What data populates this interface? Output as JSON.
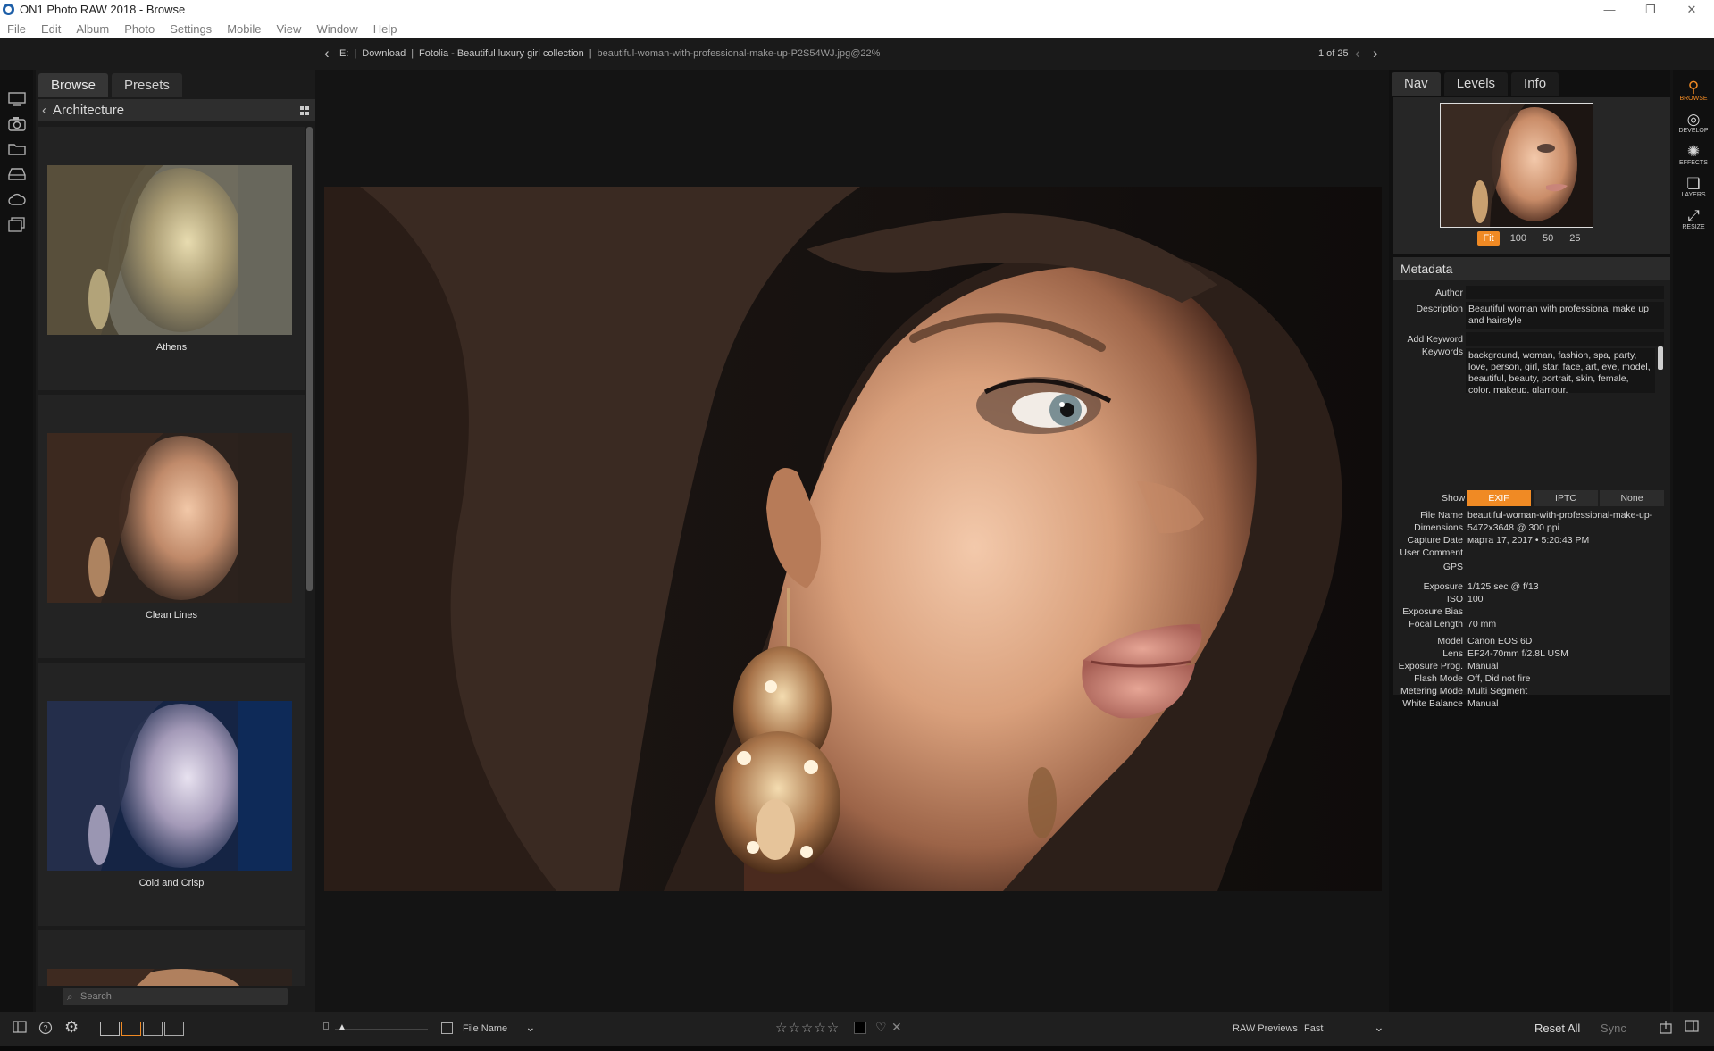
{
  "window": {
    "title": "ON1 Photo RAW 2018 - Browse",
    "controls": [
      "—",
      "❐",
      "✕"
    ]
  },
  "menu": [
    "File",
    "Edit",
    "Album",
    "Photo",
    "Settings",
    "Mobile",
    "View",
    "Window",
    "Help"
  ],
  "pathbar": {
    "drive": "E:",
    "folder1": "Download",
    "folder2": "Fotolia - Beautiful luxury girl collection",
    "file": "beautiful-woman-with-professional-make-up-P2S54WJ.jpg@22%",
    "counter": "1 of 25"
  },
  "left_tabs": {
    "browse": "Browse",
    "presets": "Presets"
  },
  "preset_category": "Architecture",
  "presets": [
    {
      "label": "Athens"
    },
    {
      "label": "Clean Lines"
    },
    {
      "label": "Cold and Crisp"
    }
  ],
  "search": {
    "placeholder": "Search"
  },
  "right_tabs": {
    "nav": "Nav",
    "levels": "Levels",
    "info": "Info"
  },
  "zoom_options": [
    "Fit",
    "100",
    "50",
    "25"
  ],
  "metadata": {
    "title": "Metadata",
    "author_label": "Author",
    "author": "",
    "description_label": "Description",
    "description": "Beautiful woman with professional make up and hairstyle",
    "add_keyword_label": "Add Keyword",
    "keywords_label": "Keywords",
    "keywords": "background, woman, fashion, spa, party, love, person, girl, star, face, art, eye, model, beautiful, beauty, portrait, skin, female, color, makeup, glamour,",
    "show_label": "Show",
    "show_options": [
      "EXIF",
      "IPTC",
      "None"
    ],
    "exif": [
      {
        "k": "File Name",
        "v": "beautiful-woman-with-professional-make-up-"
      },
      {
        "k": "Dimensions",
        "v": "5472x3648 @ 300 ppi"
      },
      {
        "k": "Capture Date",
        "v": "марта 17, 2017 • 5:20:43 PM"
      },
      {
        "k": "User Comment",
        "v": ""
      },
      {
        "k": "GPS",
        "v": ""
      },
      {
        "k": "Exposure",
        "v": "1/125 sec @ f/13"
      },
      {
        "k": "ISO",
        "v": "100"
      },
      {
        "k": "Exposure Bias",
        "v": ""
      },
      {
        "k": "Focal Length",
        "v": "70 mm"
      },
      {
        "k": "Model",
        "v": "Canon EOS 6D"
      },
      {
        "k": "Lens",
        "v": "EF24-70mm f/2.8L USM"
      },
      {
        "k": "Exposure Prog.",
        "v": "Manual"
      },
      {
        "k": "Flash Mode",
        "v": "Off, Did not fire"
      },
      {
        "k": "Metering Mode",
        "v": "Multi Segment"
      },
      {
        "k": "White Balance",
        "v": "Manual"
      }
    ]
  },
  "modules": [
    "BROWSE",
    "DEVELOP",
    "EFFECTS",
    "LAYERS",
    "RESIZE"
  ],
  "bottom": {
    "sort_label": "File Name",
    "raw_previews_label": "RAW Previews",
    "raw_previews_value": "Fast",
    "reset_all": "Reset All",
    "sync": "Sync"
  },
  "colors": {
    "accent": "#f08a24"
  }
}
